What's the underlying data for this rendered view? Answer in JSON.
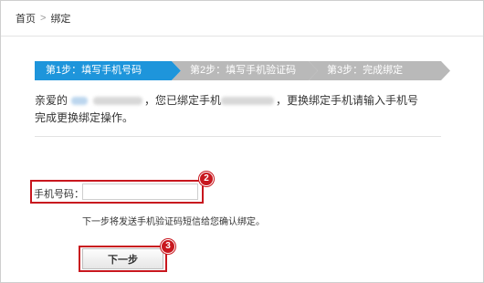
{
  "breadcrumb": {
    "home": "首页",
    "separator": ">",
    "current": "绑定"
  },
  "steps": [
    {
      "label": "第1步：填写手机号码",
      "active": true
    },
    {
      "label": "第2步：填写手机验证码",
      "active": false
    },
    {
      "label": "第3步：完成绑定",
      "active": false
    }
  ],
  "colors": {
    "step_active": "#1e95db",
    "step_inactive": "#b9b9b9",
    "highlight": "#c8171e"
  },
  "description": {
    "greeting": "亲爱的",
    "part2": "，您已绑定手机",
    "part3": "，更换绑定手机请输入手机号",
    "line2": "完成更换绑定操作。"
  },
  "form": {
    "phone_label": "手机号码：",
    "phone_value": "",
    "hint": "下一步将发送手机验证码短信给您确认绑定。",
    "next_label": "下一步"
  },
  "callouts": {
    "input_number": "2",
    "button_number": "3"
  }
}
